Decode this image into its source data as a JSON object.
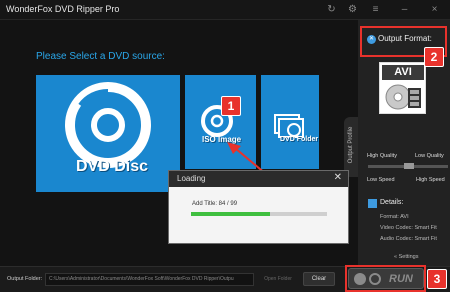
{
  "titlebar": {
    "title": "WonderFox DVD Ripper Pro",
    "icons": [
      "refresh-icon",
      "gear-icon",
      "menu-icon",
      "minimize-icon",
      "close-icon"
    ],
    "minimize_glyph": "–",
    "close_glyph": "×",
    "refresh_glyph": "↻",
    "gear_glyph": "⚙",
    "menu_glyph": "≡"
  },
  "main": {
    "prompt": "Please Select a DVD source:",
    "sources": [
      {
        "label": "DVD Disc",
        "icon": "disc-icon"
      },
      {
        "label": "ISO Image",
        "icon": "iso-disc-icon"
      },
      {
        "label": "DVD Folder",
        "icon": "folder-icon"
      }
    ],
    "profile_tab": "Output Profile"
  },
  "dialog": {
    "title": "Loading",
    "close_glyph": "✕",
    "status": "Add Title: 84 / 99",
    "progress": 0.58
  },
  "annotations": {
    "badge_1": "1",
    "badge_2": "2",
    "badge_3": "3"
  },
  "side": {
    "output_format_label": "Output Format:",
    "format_name": "AVI",
    "quality_high": "High Quality",
    "quality_low": "Low Quality",
    "speed_low": "Low Speed",
    "speed_high": "High Speed",
    "details_label": "Details:",
    "details": [
      "Format: AVI",
      "Video Codec: Smart Fit",
      "Audio Codec: Smart Fit"
    ],
    "settings": "« Settings"
  },
  "bottombar": {
    "output_folder_label": "Output Folder:",
    "output_path": "C:\\Users\\Administrator\\Documents\\WonderFox Soft\\WonderFox DVD Ripper\\Outpu",
    "open_folder": "Open Folder",
    "clear": "Clear",
    "run": "RUN"
  },
  "colors": {
    "accent": "#1a87cf",
    "badge": "#e8322c",
    "progress": "#3fbf3f"
  }
}
